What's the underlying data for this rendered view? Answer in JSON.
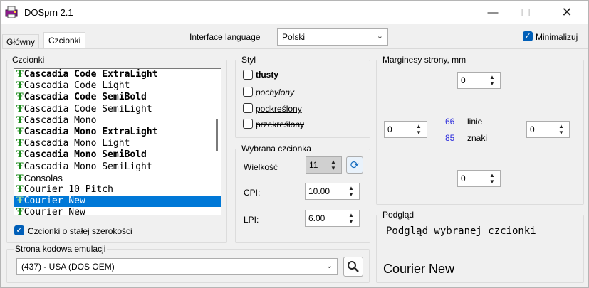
{
  "window": {
    "title": "DOSprn 2.1",
    "min_label": "—",
    "max_label": "☐",
    "close_label": "✕"
  },
  "tabs": [
    {
      "label": "Główny"
    },
    {
      "label": "Czcionki"
    }
  ],
  "interface_language": {
    "label": "Interface language",
    "value": "Polski"
  },
  "minimize": {
    "label": "Minimalizuj",
    "checked": true
  },
  "fonts_group": {
    "title": "Czcionki",
    "items": [
      {
        "name": "Cascadia Code ExtraLight"
      },
      {
        "name": "Cascadia Code Light"
      },
      {
        "name": "Cascadia Code SemiBold"
      },
      {
        "name": "Cascadia Code SemiLight"
      },
      {
        "name": "Cascadia Mono"
      },
      {
        "name": "Cascadia Mono ExtraLight"
      },
      {
        "name": "Cascadia Mono Light"
      },
      {
        "name": "Cascadia Mono SemiBold"
      },
      {
        "name": "Cascadia Mono SemiLight"
      },
      {
        "name": "Consolas"
      },
      {
        "name": "Courier 10 Pitch"
      },
      {
        "name": "Courier New"
      },
      {
        "name": "Courier New"
      }
    ],
    "selected_index": 11,
    "fixed_width": {
      "label": "Czcionki o stałej szerokości",
      "checked": true
    }
  },
  "style_group": {
    "title": "Styl",
    "bold": {
      "label": "tłusty",
      "checked": false
    },
    "italic": {
      "label": "pochylony",
      "checked": false
    },
    "underline": {
      "label": "podkreślony",
      "checked": false
    },
    "strikeout": {
      "label": "przekreślony",
      "checked": false
    }
  },
  "selected_font_group": {
    "title": "Wybrana czcionka",
    "size": {
      "label": "Wielkość",
      "value": "11"
    },
    "cpi": {
      "label": "CPI:",
      "value": "10.00"
    },
    "lpi": {
      "label": "LPI:",
      "value": "6.00"
    }
  },
  "margins_group": {
    "title": "Marginesy strony, mm",
    "top": "0",
    "left": "0",
    "right": "0",
    "bottom": "0",
    "lines": {
      "value": "66",
      "label": "linie"
    },
    "chars": {
      "value": "85",
      "label": "znaki"
    }
  },
  "preview_group": {
    "title": "Podgląd",
    "sample": "Podgląd wybranej czcionki",
    "font_name": "Courier New"
  },
  "codepage_group": {
    "title": "Strona kodowa emulacji",
    "value": "(437) - USA (DOS OEM)"
  }
}
